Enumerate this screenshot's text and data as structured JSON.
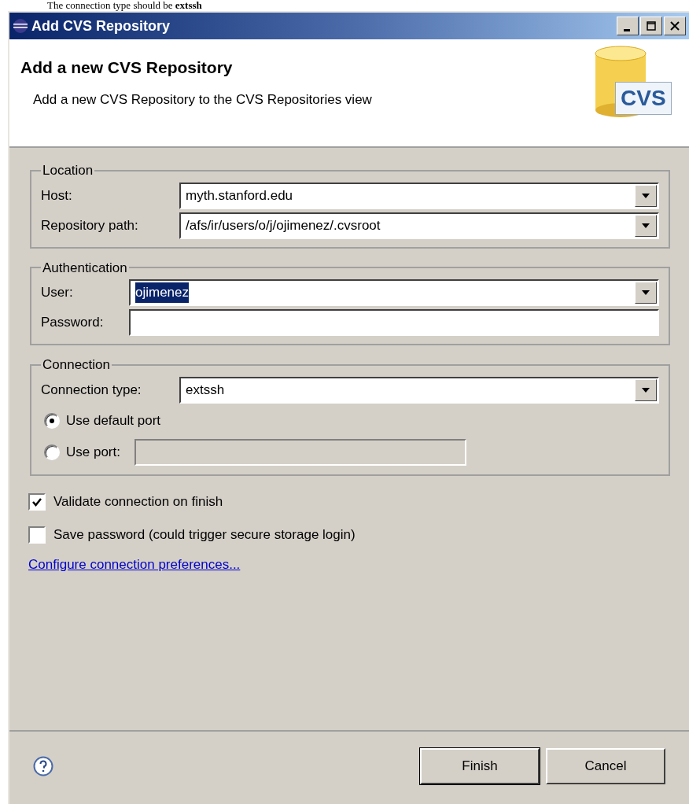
{
  "caption": "The connection type should be **extssh**",
  "window": {
    "title": "Add CVS Repository"
  },
  "header": {
    "title": "Add a new CVS Repository",
    "description": "Add a new CVS Repository to the CVS Repositories view",
    "logo_text": "CVS"
  },
  "groups": [
    {
      "title": "Location",
      "fields": [
        {
          "kind": "combo",
          "label": "Host:",
          "value": "myth.stanford.edu"
        },
        {
          "kind": "combo",
          "label": "Repository path:",
          "value": "/afs/ir/users/o/j/ojimenez/.cvsroot"
        }
      ]
    },
    {
      "title": "Authentication",
      "fields": [
        {
          "kind": "combo",
          "label": "User:",
          "value": "ojimenez",
          "selected_text": true
        },
        {
          "kind": "text",
          "label": "Password:"
        }
      ]
    },
    {
      "title": "Connection",
      "fields": [
        {
          "kind": "combo",
          "label": "Connection type:",
          "value": "extssh"
        },
        {
          "kind": "radio",
          "label": "Use default port",
          "selected": true
        },
        {
          "kind": "radio_text",
          "label": "Use port:",
          "selected": false,
          "disabled": true
        }
      ]
    }
  ],
  "checkboxes": [
    {
      "label": "Validate connection on finish",
      "checked": true
    },
    {
      "label": "Save password (could trigger secure storage login)",
      "checked": false
    }
  ],
  "link": "Configure connection preferences...",
  "buttons": [
    {
      "label": "Finish",
      "default": true
    },
    {
      "label": "Cancel",
      "default": false
    }
  ]
}
